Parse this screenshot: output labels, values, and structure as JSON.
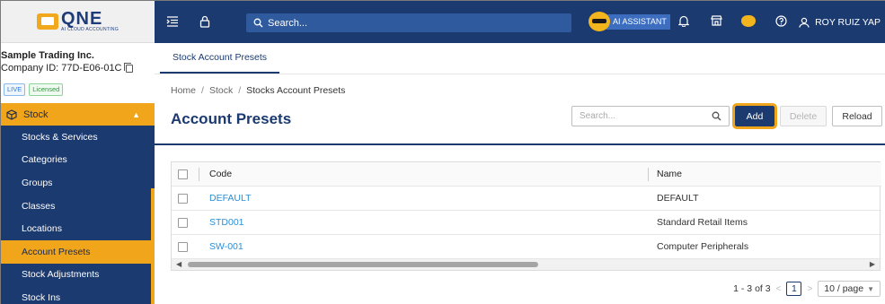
{
  "brand": {
    "logo_name": "QNE",
    "logo_sub": "AI CLOUD ACCOUNTING"
  },
  "company": {
    "name": "Sample Trading Inc.",
    "id": "Company ID: 77D-E06-01C"
  },
  "badges": {
    "live": "LIVE",
    "licensed": "Licensed"
  },
  "sidebar": {
    "parent": "Stock",
    "items": [
      {
        "label": "Stocks & Services"
      },
      {
        "label": "Categories"
      },
      {
        "label": "Groups"
      },
      {
        "label": "Classes"
      },
      {
        "label": "Locations"
      },
      {
        "label": "Account Presets"
      },
      {
        "label": "Stock Adjustments"
      },
      {
        "label": "Stock Ins"
      }
    ],
    "active_index": 5
  },
  "topbar": {
    "search_placeholder": "Search...",
    "ai_label": "AI ASSISTANT",
    "user_name": "ROY RUIZ YAP"
  },
  "tabs": [
    {
      "label": "Stock Account Presets"
    }
  ],
  "breadcrumb": {
    "home": "Home",
    "section": "Stock",
    "current": "Stocks Account Presets"
  },
  "page": {
    "title": "Account Presets",
    "search_placeholder": "Search...",
    "add_label": "Add",
    "delete_label": "Delete",
    "reload_label": "Reload"
  },
  "table": {
    "columns": [
      "Code",
      "Name"
    ],
    "rows": [
      {
        "code": "DEFAULT",
        "name": "DEFAULT"
      },
      {
        "code": "STD001",
        "name": "Standard Retail Items"
      },
      {
        "code": "SW-001",
        "name": "Computer Peripherals"
      }
    ]
  },
  "pagination": {
    "range": "1 - 3 of 3",
    "page": "1",
    "page_size": "10 / page"
  },
  "colors": {
    "navy": "#1b3a70",
    "accent": "#f0a51a",
    "link": "#2a8fd6"
  }
}
